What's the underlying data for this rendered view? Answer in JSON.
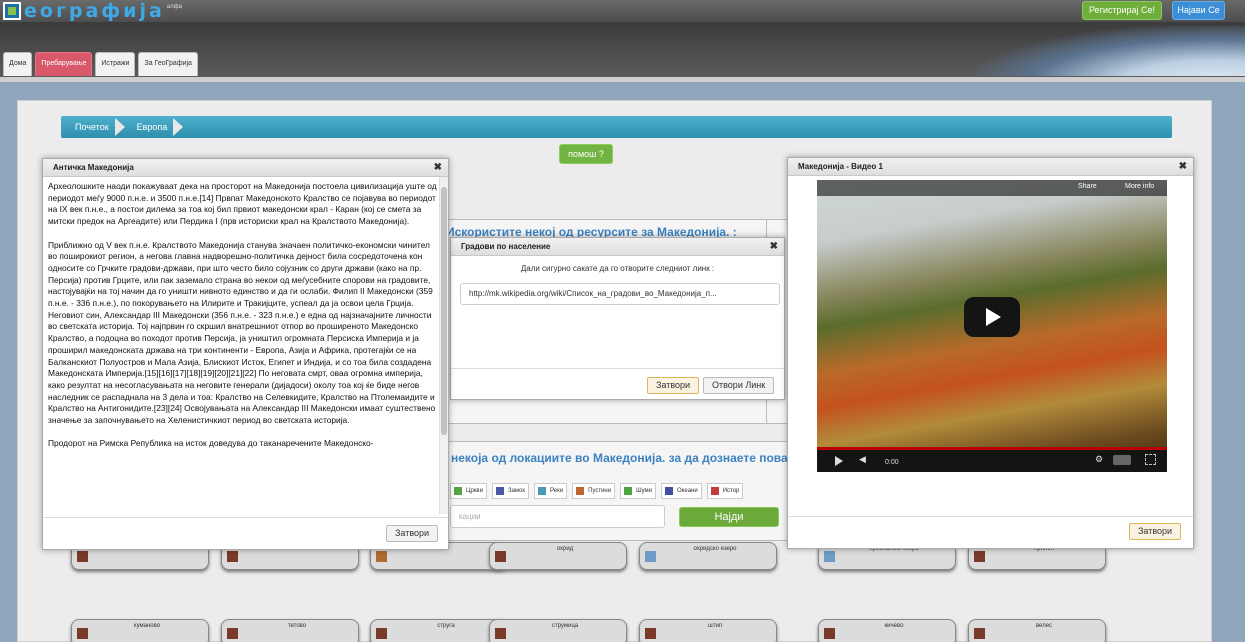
{
  "header": {
    "logo_text": "еографија",
    "logo_sup": "алфа",
    "register_label": "Регистрирај Се!",
    "login_label": "Најави Се"
  },
  "nav": {
    "tabs": [
      {
        "label": "Дома",
        "active": false
      },
      {
        "label": "Пребарување",
        "active": true
      },
      {
        "label": "Истражи",
        "active": false
      },
      {
        "label": "За ГеоГрафија",
        "active": false
      }
    ]
  },
  "breadcrumb": [
    "Почеток",
    "Европа"
  ],
  "help_label": "помош ?",
  "resources_heading": "Искористите некој од ресурсите за Македонија. :",
  "locations_heading": "некоја од локациите во Македонија. за да дознаете пова",
  "legend": [
    {
      "label": "Цркви",
      "color": "#57a640"
    },
    {
      "label": "Замок",
      "color": "#4a5aa8"
    },
    {
      "label": "Реки",
      "color": "#4a9bb5"
    },
    {
      "label": "Пустини",
      "color": "#c0642f"
    },
    {
      "label": "Шуми",
      "color": "#4aa63a"
    },
    {
      "label": "Океани",
      "color": "#3e4fa3"
    },
    {
      "label": "Истор",
      "color": "#c43b3b"
    }
  ],
  "search": {
    "placeholder": "кации",
    "button": "Најди"
  },
  "tiles_row1": [
    {
      "label": "охрид",
      "color": "#7a3a2a"
    },
    {
      "label": "охридско езеро",
      "color": "#6f9bc6"
    },
    {
      "label": "преспанско езеро",
      "color": "#6f9bc6"
    },
    {
      "label": "прилеп",
      "color": "#7a3a2a"
    }
  ],
  "tiles_row2": [
    {
      "label": "куманово",
      "color": "#7a3a2a"
    },
    {
      "label": "тетово",
      "color": "#7a3a2a"
    },
    {
      "label": "струга",
      "color": "#7a3a2a"
    },
    {
      "label": "струмица",
      "color": "#7a3a2a"
    },
    {
      "label": "штип",
      "color": "#7a3a2a"
    },
    {
      "label": "кичево",
      "color": "#7a3a2a"
    },
    {
      "label": "велес",
      "color": "#7a3a2a"
    }
  ],
  "article_dialog": {
    "title": "Античка Македонија",
    "paragraphs": [
      "Археолошките наоди покажуваат дека на просторот на Македонија постоела цивилизација уште од периодот меѓу 9000 п.н.е. и 3500 п.н.е.[14] Првпат Македонското Кралство се појавува во периодот на IX век п.н.е., а постои дилема за тоа кој бил првиот македонски крал - Каран (кој се смета за митски предок на Аргеадите) или Пердика I (прв историски крал на Кралството Македонија).",
      "Приближно од V век п.н.е. Кралството Македонија станува значаен политичко-економски чинител во поширокиот регион, а негова главна надворешно-политичка дејност била сосредоточена кон односите со Грчките градови-држави, при што често било сојузник со други држави (како на пр. Персија) против Грците, или пак заземало страна во некои од меѓусебните спорови на градовите, настојувајќи на тој начин да го уништи нивното единство и да ги ослаби. Филип II Македонски (359 п.н.е. - 336 п.н.е.), по покорувањето на Илирите и Тракијците, успеал да ја освои цела Грција. Неговиот син, Александар III Македонски (356 п.н.е. - 323 п.н.е.) е една од најзначајните личности во светската историја. Тој најпрвин го скршил внатрешниот отпор во проширеното Македонско Кралство, а подоцна во походот против Персија, ја уништил огромната Персиска Империја и ја проширил македонската држава на три континенти - Европа, Азија и Африка, протегајќи се на Балканскиот Полуостров и Мала Азија, Блискиот Исток, Египет и Индија, и со тоа била создадена Македонската Империја.[15][16][17][18][19][20][21][22] По неговата смрт, оваа огромна империја, како резултат на несогласувањата на неговите генерали (дијадоси) околу тоа кој ќе биде негов наследник се распаднала на 3 дела и тоа: Кралство на Селевкидите, Кралство на Птолемаидите и Кралство на Антигонидите.[23][24] Освојувањата на Александар III Македонски имаат суштествено значење за започнувањето на Хеленистичкиот период во светската историја.",
      "Продорот на Римска Република на исток доведува до таканаречените Македонско-"
    ],
    "close_label": "Затвори"
  },
  "link_dialog": {
    "title": "Градови по население",
    "message": "Дали сигурно сакате да го отворите следниот линк :",
    "url": "http://mk.wikipedia.org/wiki/Список_на_градови_во_Македонија_п...",
    "close_label": "Затвори",
    "open_label": "Отвори Линк"
  },
  "video_dialog": {
    "title": "Македонија - Видео 1",
    "share_label": "Share",
    "info_label": "More info",
    "time": "0:00",
    "close_label": "Затвори"
  }
}
